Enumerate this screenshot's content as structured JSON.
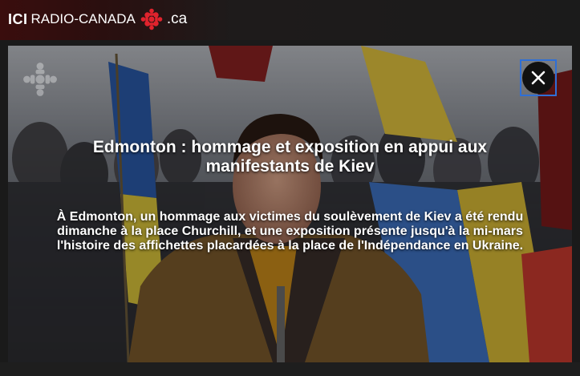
{
  "brand": {
    "ici": "ICI",
    "name": "RADIO-CANADA",
    "domain": ".ca",
    "gem_color": "#e0232d"
  },
  "video": {
    "title": "Edmonton : hommage et exposition en appui aux manifestants de Kiev",
    "description": "À Edmonton, un hommage aux victimes du soulèvement de Kiev a été rendu dimanche à la place Churchill, et une exposition présente jusqu'à la mi-mars l'histoire des affichettes placardées à la place de l'Indépendance en Ukraine.",
    "close_icon": "close-icon",
    "watermark_icon": "radio-canada-gem-icon",
    "focus_color": "#2f6fd6"
  }
}
